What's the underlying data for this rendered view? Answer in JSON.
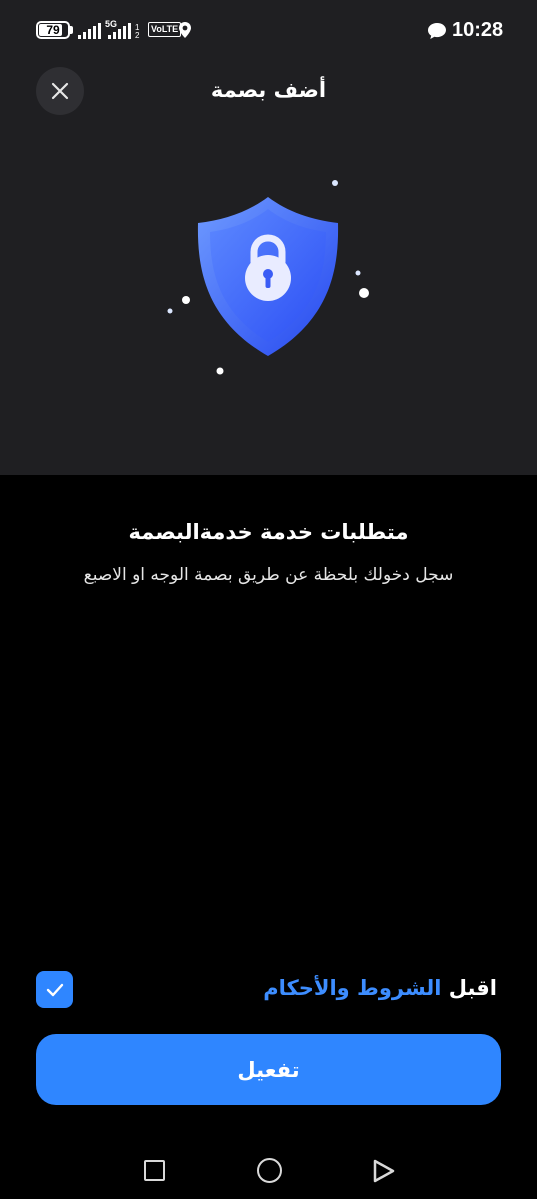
{
  "status_bar": {
    "battery": "79",
    "network": "5G",
    "volte": "VoLTE",
    "time": "10:28"
  },
  "header": {
    "title": "أضف بصمة",
    "close_icon": "close-icon"
  },
  "illustration": {
    "icon": "shield-lock-icon",
    "colors": {
      "shield_light": "#5b8cff",
      "shield_dark": "#2a52f0",
      "lock": "#e9ecff"
    }
  },
  "content": {
    "title": "متطلبات خدمة خدمةالبصمة",
    "subtitle": "سجل دخولك بلحظة عن طريق بصمة الوجه او الاصبع"
  },
  "terms": {
    "prefix": "اقبل ",
    "link": "الشروط والأحكام",
    "checked": true
  },
  "actions": {
    "activate_label": "تفعيل"
  },
  "colors": {
    "accent": "#2f86ff",
    "panel": "#1f1f22",
    "background": "#000000"
  },
  "nav": {
    "recents_icon": "square-icon",
    "home_icon": "circle-icon",
    "back_icon": "triangle-back-icon"
  }
}
